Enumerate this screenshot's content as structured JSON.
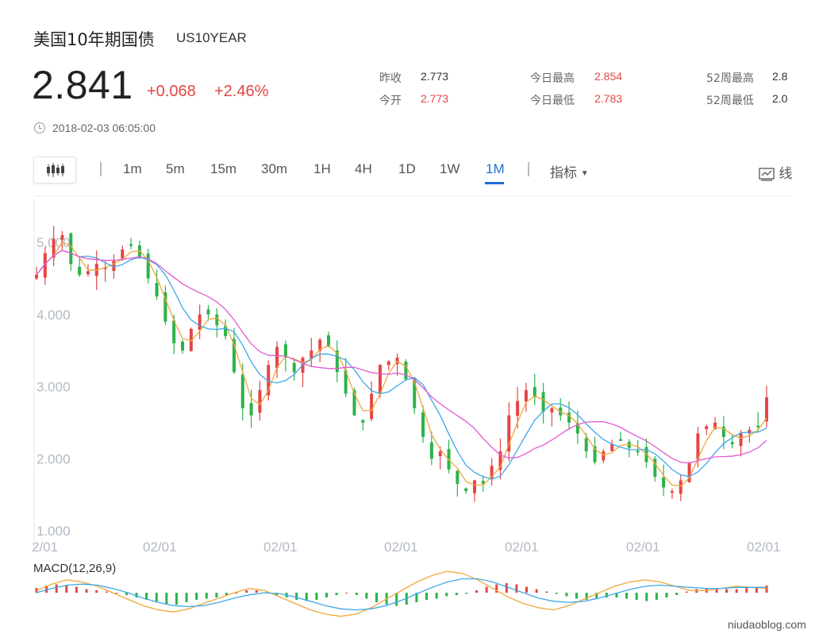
{
  "header": {
    "title": "美国10年期国债",
    "symbol": "US10YEAR",
    "price": "2.841",
    "change": "+0.068",
    "change_pct": "+2.46%",
    "timestamp": "2018-02-03 06:05:00"
  },
  "stats": [
    {
      "label": "昨收",
      "value": "2.773",
      "color": "#333333"
    },
    {
      "label": "今开",
      "value": "2.773",
      "color": "#e54545"
    },
    {
      "label": "今日最高",
      "value": "2.854",
      "color": "#e54545"
    },
    {
      "label": "今日最低",
      "value": "2.783",
      "color": "#e54545"
    },
    {
      "label": "52周最高",
      "value": "2.8",
      "color": "#333333"
    },
    {
      "label": "52周最低",
      "value": "2.0",
      "color": "#333333"
    }
  ],
  "toolbar": {
    "tabs": [
      "1m",
      "5m",
      "15m",
      "30m",
      "1H",
      "4H",
      "1D",
      "1W",
      "1M"
    ],
    "active_tab": "1M",
    "indicator_label": "指标",
    "line_label": "线"
  },
  "colors": {
    "up": "#e54545",
    "down": "#2bb34a",
    "ma_short": "#f0a73c",
    "ma_mid": "#3fa9e8",
    "ma_long": "#e35ad2",
    "active": "#1e6fd9"
  },
  "watermark": "niudaoblog.com",
  "chart_data": {
    "type": "candlestick",
    "y_ticks": [
      "5.000",
      "4.000",
      "3.000",
      "2.000",
      "1.000"
    ],
    "ylim": [
      1.0,
      5.5
    ],
    "x_tick_labels": [
      "2/01",
      "02/01",
      "02/01",
      "02/01",
      "02/01",
      "02/01",
      "02/01"
    ],
    "close_path": [
      4.55,
      4.85,
      5.05,
      5.1,
      4.7,
      4.55,
      4.6,
      4.7,
      4.65,
      4.75,
      4.9,
      4.95,
      4.8,
      4.5,
      4.25,
      3.9,
      3.6,
      3.5,
      3.8,
      4.0,
      4.0,
      3.85,
      3.7,
      3.2,
      2.7,
      2.6,
      2.95,
      3.3,
      3.55,
      3.4,
      3.2,
      3.4,
      3.5,
      3.65,
      3.55,
      3.2,
      2.9,
      2.6,
      2.5,
      2.9,
      3.3,
      3.35,
      3.4,
      3.1,
      2.7,
      2.3,
      2.0,
      2.1,
      1.85,
      1.65,
      1.55,
      1.7,
      1.65,
      1.9,
      2.1,
      2.6,
      2.8,
      2.95,
      2.85,
      2.65,
      2.7,
      2.6,
      2.5,
      2.35,
      2.1,
      1.95,
      2.1,
      2.2,
      2.25,
      2.15,
      2.1,
      1.95,
      1.75,
      1.6,
      1.55,
      1.7,
      1.95,
      2.35,
      2.45,
      2.5,
      2.3,
      2.2,
      2.35,
      2.4,
      2.45,
      2.85
    ],
    "macd": {
      "label": "MACD(12,26,9)",
      "hist": [
        0.04,
        0.06,
        0.07,
        0.06,
        0.05,
        0.03,
        0.02,
        0.01,
        0.0,
        -0.02,
        -0.04,
        -0.06,
        -0.08,
        -0.1,
        -0.1,
        -0.08,
        -0.06,
        -0.05,
        -0.04,
        -0.02,
        0.0,
        0.02,
        0.02,
        0.0,
        -0.02,
        -0.04,
        -0.06,
        -0.07,
        -0.06,
        -0.04,
        -0.02,
        0.0,
        -0.02,
        -0.05,
        -0.08,
        -0.1,
        -0.11,
        -0.1,
        -0.08,
        -0.06,
        -0.05,
        -0.03,
        -0.02,
        -0.01,
        0.02,
        0.05,
        0.07,
        0.08,
        0.07,
        0.05,
        0.03,
        0.01,
        -0.01,
        -0.03,
        -0.05,
        -0.06,
        -0.05,
        -0.04,
        -0.04,
        -0.05,
        -0.06,
        -0.07,
        -0.06,
        -0.04,
        -0.02,
        0.01,
        0.03,
        0.04,
        0.04,
        0.03,
        0.03,
        0.04,
        0.05,
        0.06
      ],
      "dif": [
        0.02,
        0.08,
        0.12,
        0.1,
        0.06,
        0.0,
        -0.06,
        -0.12,
        -0.16,
        -0.18,
        -0.15,
        -0.1,
        -0.05,
        0.0,
        0.04,
        0.02,
        -0.04,
        -0.1,
        -0.16,
        -0.2,
        -0.22,
        -0.2,
        -0.14,
        -0.06,
        0.02,
        0.1,
        0.16,
        0.2,
        0.18,
        0.12,
        0.04,
        -0.04,
        -0.1,
        -0.14,
        -0.16,
        -0.12,
        -0.06,
        0.0,
        0.06,
        0.1,
        0.12,
        0.1,
        0.06,
        0.02,
        0.02,
        0.04,
        0.06,
        0.05,
        0.04
      ],
      "dea": [
        0.0,
        0.04,
        0.07,
        0.08,
        0.07,
        0.04,
        0.0,
        -0.05,
        -0.09,
        -0.12,
        -0.13,
        -0.12,
        -0.09,
        -0.05,
        -0.02,
        0.0,
        -0.01,
        -0.04,
        -0.08,
        -0.12,
        -0.15,
        -0.16,
        -0.15,
        -0.12,
        -0.07,
        -0.01,
        0.05,
        0.1,
        0.13,
        0.13,
        0.1,
        0.05,
        0.0,
        -0.05,
        -0.08,
        -0.09,
        -0.08,
        -0.05,
        -0.01,
        0.03,
        0.06,
        0.07,
        0.06,
        0.05,
        0.04,
        0.04,
        0.05,
        0.05,
        0.05
      ]
    }
  }
}
